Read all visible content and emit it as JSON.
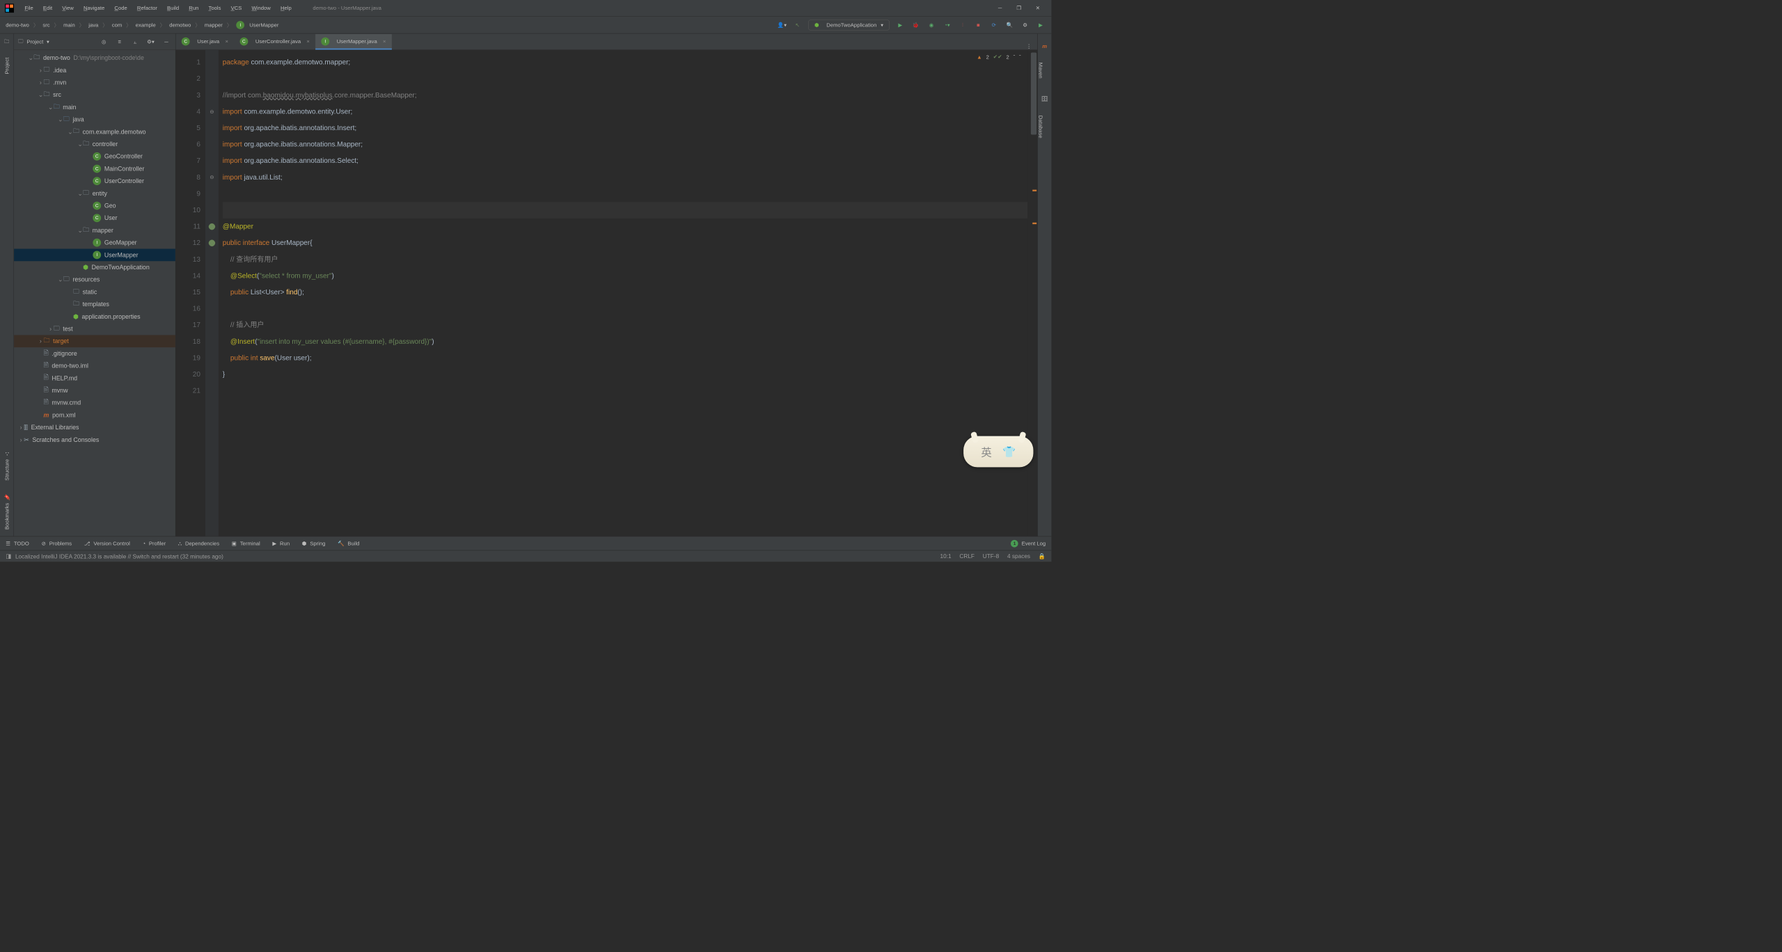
{
  "title": "demo-two - UserMapper.java",
  "menus": [
    "File",
    "Edit",
    "View",
    "Navigate",
    "Code",
    "Refactor",
    "Build",
    "Run",
    "Tools",
    "VCS",
    "Window",
    "Help"
  ],
  "breadcrumb": [
    "demo-two",
    "src",
    "main",
    "java",
    "com",
    "example",
    "demotwo",
    "mapper",
    "UserMapper"
  ],
  "runConfig": "DemoTwoApplication",
  "projectPanel": {
    "title": "Project",
    "rootName": "demo-two",
    "rootPath": "D:\\my\\springboot-code\\de",
    "nodes": [
      {
        "label": ".idea",
        "indent": 2,
        "arrow": ">",
        "type": "folder"
      },
      {
        "label": ".mvn",
        "indent": 2,
        "arrow": ">",
        "type": "folder"
      },
      {
        "label": "src",
        "indent": 2,
        "arrow": "v",
        "type": "folder"
      },
      {
        "label": "main",
        "indent": 3,
        "arrow": "v",
        "type": "folder-blue"
      },
      {
        "label": "java",
        "indent": 4,
        "arrow": "v",
        "type": "folder-blue"
      },
      {
        "label": "com.example.demotwo",
        "indent": 5,
        "arrow": "v",
        "type": "folder"
      },
      {
        "label": "controller",
        "indent": 6,
        "arrow": "v",
        "type": "folder"
      },
      {
        "label": "GeoController",
        "indent": 7,
        "arrow": "",
        "type": "class"
      },
      {
        "label": "MainController",
        "indent": 7,
        "arrow": "",
        "type": "class"
      },
      {
        "label": "UserController",
        "indent": 7,
        "arrow": "",
        "type": "class"
      },
      {
        "label": "entity",
        "indent": 6,
        "arrow": "v",
        "type": "folder"
      },
      {
        "label": "Geo",
        "indent": 7,
        "arrow": "",
        "type": "class"
      },
      {
        "label": "User",
        "indent": 7,
        "arrow": "",
        "type": "class"
      },
      {
        "label": "mapper",
        "indent": 6,
        "arrow": "v",
        "type": "folder"
      },
      {
        "label": "GeoMapper",
        "indent": 7,
        "arrow": "",
        "type": "interface"
      },
      {
        "label": "UserMapper",
        "indent": 7,
        "arrow": "",
        "type": "interface",
        "selected": true
      },
      {
        "label": "DemoTwoApplication",
        "indent": 6,
        "arrow": "",
        "type": "spring"
      },
      {
        "label": "resources",
        "indent": 4,
        "arrow": "v",
        "type": "folder-res"
      },
      {
        "label": "static",
        "indent": 5,
        "arrow": "",
        "type": "folder"
      },
      {
        "label": "templates",
        "indent": 5,
        "arrow": "",
        "type": "folder"
      },
      {
        "label": "application.properties",
        "indent": 5,
        "arrow": "",
        "type": "spring-file"
      },
      {
        "label": "test",
        "indent": 3,
        "arrow": ">",
        "type": "folder"
      },
      {
        "label": "target",
        "indent": 2,
        "arrow": ">",
        "type": "folder-orange"
      },
      {
        "label": ".gitignore",
        "indent": 2,
        "arrow": "",
        "type": "file"
      },
      {
        "label": "demo-two.iml",
        "indent": 2,
        "arrow": "",
        "type": "file"
      },
      {
        "label": "HELP.md",
        "indent": 2,
        "arrow": "",
        "type": "file"
      },
      {
        "label": "mvnw",
        "indent": 2,
        "arrow": "",
        "type": "file"
      },
      {
        "label": "mvnw.cmd",
        "indent": 2,
        "arrow": "",
        "type": "file"
      },
      {
        "label": "pom.xml",
        "indent": 2,
        "arrow": "",
        "type": "maven"
      }
    ],
    "externalLibraries": "External Libraries",
    "scratches": "Scratches and Consoles"
  },
  "tabs": [
    {
      "label": "User.java",
      "icon": "class"
    },
    {
      "label": "UserController.java",
      "icon": "class"
    },
    {
      "label": "UserMapper.java",
      "icon": "interface",
      "active": true
    }
  ],
  "editor": {
    "warnings": "2",
    "checks": "2",
    "lines": [
      {
        "n": 1,
        "html": "<span class='kw'>package</span> <span class='pkg'>com.example.demotwo.mapper</span><span class='id'>;</span>"
      },
      {
        "n": 2,
        "html": ""
      },
      {
        "n": 3,
        "html": "<span class='cm'>//import com.<span class='wavy'>baomidou</span>.<span class='wavy'>mybatisplus</span>.core.mapper.BaseMapper;</span>"
      },
      {
        "n": 4,
        "html": "<span class='kw'>import</span> <span class='pkg'>com.example.demotwo.entity.User</span><span class='id'>;</span>",
        "fold": true
      },
      {
        "n": 5,
        "html": "<span class='kw'>import</span> <span class='pkg'>org.apache.ibatis.annotations.Insert</span><span class='id'>;</span>"
      },
      {
        "n": 6,
        "html": "<span class='kw'>import</span> <span class='pkg'>org.apache.ibatis.annotations.Mapper</span><span class='id'>;</span>"
      },
      {
        "n": 7,
        "html": "<span class='kw'>import</span> <span class='pkg'>org.apache.ibatis.annotations.Select</span><span class='id'>;</span>"
      },
      {
        "n": 8,
        "html": "<span class='kw'>import</span> <span class='pkg'>java.util.List</span><span class='id'>;</span>",
        "foldend": true
      },
      {
        "n": 9,
        "html": ""
      },
      {
        "n": 10,
        "html": "",
        "current": true
      },
      {
        "n": 11,
        "html": "<span class='ann'>@Mapper</span>",
        "leaf": true
      },
      {
        "n": 12,
        "html": "<span class='kw'>public interface</span> <span class='typ'>UserMapper</span><span class='id'>{</span>",
        "leaf": true
      },
      {
        "n": 13,
        "html": "    <span class='cm'>// 查询所有用户</span>"
      },
      {
        "n": 14,
        "html": "    <span class='ann'>@Select</span><span class='id'>(</span><span class='str'>\"select * from my_user\"</span><span class='id'>)</span>"
      },
      {
        "n": 15,
        "html": "    <span class='kw'>public</span> <span class='typ'>List</span><span class='id'>&lt;</span><span class='typ'>User</span><span class='id'>&gt; </span><span class='cls'>find</span><span class='id'>();</span>"
      },
      {
        "n": 16,
        "html": ""
      },
      {
        "n": 17,
        "html": "    <span class='cm'>// 插入用户</span>"
      },
      {
        "n": 18,
        "html": "    <span class='ann'>@Insert</span><span class='id'>(</span><span class='str'>\"insert into my_user values (#{username}, #{password})\"</span><span class='id'>)</span>"
      },
      {
        "n": 19,
        "html": "    <span class='kw'>public int</span> <span class='cls'>save</span><span class='id'>(</span><span class='typ'>User</span> <span class='id'>user);</span>"
      },
      {
        "n": 20,
        "html": "<span class='id'>}</span>"
      },
      {
        "n": 21,
        "html": ""
      }
    ]
  },
  "bottomTools": [
    "TODO",
    "Problems",
    "Version Control",
    "Profiler",
    "Dependencies",
    "Terminal",
    "Run",
    "Spring",
    "Build"
  ],
  "eventLog": "Event Log",
  "eventCount": "1",
  "statusMsg": "Localized IntelliJ IDEA 2021.3.3 is available // Switch and restart (32 minutes ago)",
  "statusRight": [
    "10:1",
    "CRLF",
    "UTF-8",
    "4 spaces"
  ],
  "leftSidebarLabels": [
    "Project",
    "Structure",
    "Bookmarks"
  ],
  "rightSidebarLabels": [
    "Maven",
    "Database"
  ],
  "imeChar": "英"
}
